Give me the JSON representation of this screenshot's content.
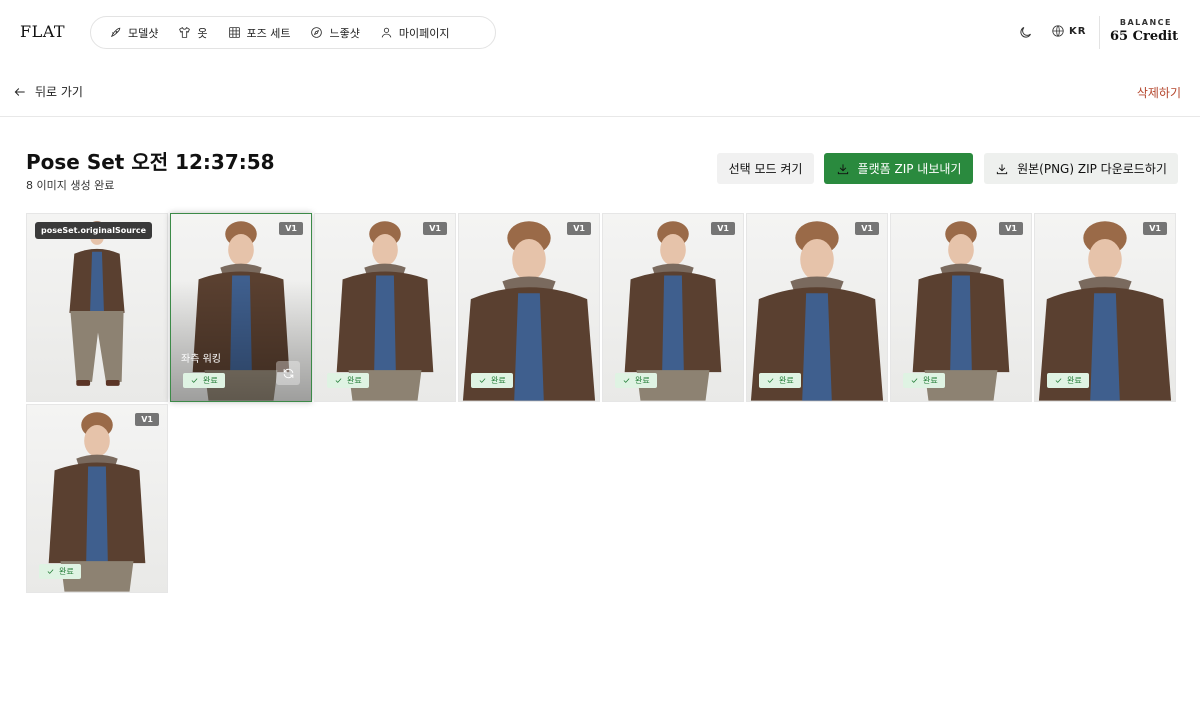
{
  "header": {
    "logo": "FLAT",
    "nav": [
      {
        "label": "모델샷",
        "icon": "rocket-icon"
      },
      {
        "label": "옷",
        "icon": "shirt-icon"
      },
      {
        "label": "포즈 세트",
        "icon": "grid-icon"
      },
      {
        "label": "느좋샷",
        "icon": "compass-icon"
      },
      {
        "label": "마이페이지",
        "icon": "user-icon"
      }
    ],
    "theme_icon": "moon-icon",
    "language": "KR",
    "balance_label": "BALANCE",
    "balance_value": "65 Credit"
  },
  "subbar": {
    "back_label": "뒤로 가기",
    "delete_label": "삭제하기"
  },
  "main": {
    "title": "Pose Set 오전 12:37:58",
    "subtitle": "8 이미지 생성 완료",
    "buttons": {
      "select_mode": "선택 모드 켜기",
      "export_zip": "플랫폼 ZIP 내보내기",
      "original_zip": "원본(PNG) ZIP 다운로드하기"
    }
  },
  "tiles": [
    {
      "kind": "source",
      "badge": "poseSet.originalSource",
      "shot": "full"
    },
    {
      "kind": "result",
      "version": "V1",
      "status": "완료",
      "pose_label": "좌측 워킹",
      "hovered": true,
      "shot": "mid"
    },
    {
      "kind": "result",
      "version": "V1",
      "status": "완료",
      "shot": "mid"
    },
    {
      "kind": "result",
      "version": "V1",
      "status": "완료",
      "shot": "close"
    },
    {
      "kind": "result",
      "version": "V1",
      "status": "완료",
      "shot": "mid"
    },
    {
      "kind": "result",
      "version": "V1",
      "status": "완료",
      "shot": "close"
    },
    {
      "kind": "result",
      "version": "V1",
      "status": "완료",
      "shot": "mid"
    },
    {
      "kind": "result",
      "version": "V1",
      "status": "완료",
      "shot": "close"
    },
    {
      "kind": "result",
      "version": "V1",
      "status": "완료",
      "shot": "mid"
    }
  ],
  "colors": {
    "accent_green": "#2a8a3e",
    "delete_red": "#b5472e",
    "done_badge_bg": "#dff3e3"
  }
}
